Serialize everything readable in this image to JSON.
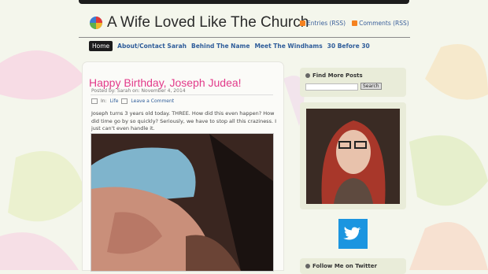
{
  "site": {
    "title": "A Wife Loved Like The Church"
  },
  "feeds": {
    "entries": "Entries (RSS)",
    "comments": "Comments (RSS)"
  },
  "nav": [
    {
      "label": "Home"
    },
    {
      "label": "About/Contact Sarah"
    },
    {
      "label": "Behind The Name"
    },
    {
      "label": "Meet The Windhams"
    },
    {
      "label": "30 Before 30"
    }
  ],
  "post": {
    "title": "Happy Birthday, Joseph Judea!",
    "meta": "Posted by: Sarah on: November 4, 2014",
    "in_label": "In:",
    "category": "Life",
    "comment_link": "Leave a Comment",
    "body": "Joseph turns 3 years old today. THREE. How did this even happen? How did time go by so quickly? Seriously, we have to stop all this craziness. I just can't even handle it."
  },
  "sidebar": {
    "find_heading": "Find More Posts",
    "search_button": "Search",
    "follow_heading": "Follow Me on Twitter"
  },
  "colors": {
    "accent": "#e23a8a",
    "link": "#2f5d9a",
    "twitter": "#1b95e0"
  }
}
